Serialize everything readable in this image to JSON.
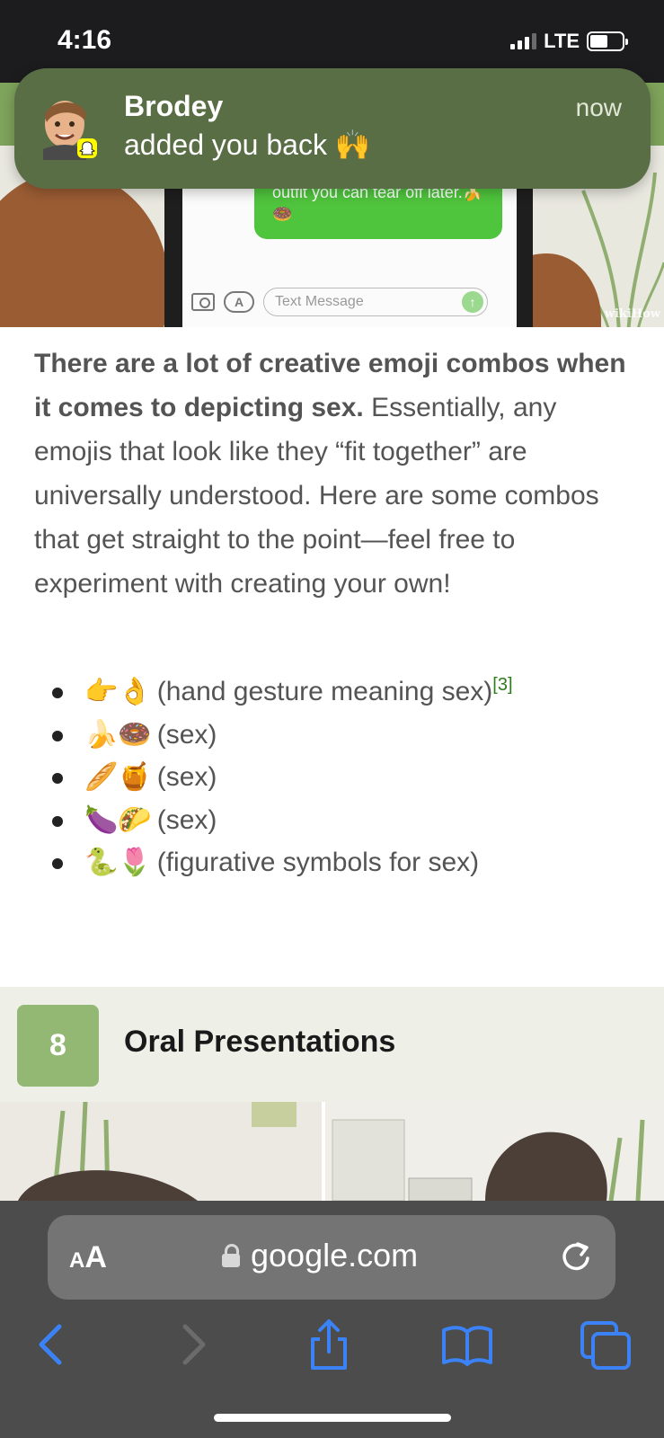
{
  "status_bar": {
    "time": "4:16",
    "network": "LTE"
  },
  "notification": {
    "sender": "Brodey",
    "message": "added you back 🙌",
    "time": "now",
    "app_icon": "snapchat-icon"
  },
  "top_image": {
    "sms_text": "Come meet me. I'm in a hot outfit you can tear off later.🍌🍩",
    "input_placeholder": "Text Message",
    "watermark": "wikiHow"
  },
  "article": {
    "bold_lead": "There are a lot of creative emoji combos when it comes to depicting sex.",
    "paragraph": "Essentially, any emojis that look like they “fit together” are universally understood. Here are some combos that get straight to the point—feel free to experiment with creating your own!",
    "bullets": [
      {
        "emoji": "👉👌",
        "text": "(hand gesture meaning sex)",
        "ref": "[3]"
      },
      {
        "emoji": "🍌🍩",
        "text": "(sex)"
      },
      {
        "emoji": "🥖🍯",
        "text": "(sex)"
      },
      {
        "emoji": "🍆🌮",
        "text": "(sex)"
      },
      {
        "emoji": "🐍🌷",
        "text": "(figurative symbols for sex)"
      }
    ]
  },
  "step": {
    "number": "8",
    "title": "Oral Presentations"
  },
  "safari": {
    "aa_small": "A",
    "aa_large": "A",
    "url": "google.com"
  },
  "colors": {
    "notification_bg": "#5a6e46",
    "step_badge": "#93b874",
    "step_header_bg": "#eef0e8",
    "link_blue": "#3b82f6",
    "ref_green": "#2e7d1a",
    "safari_bg": "#4c4c4c"
  }
}
